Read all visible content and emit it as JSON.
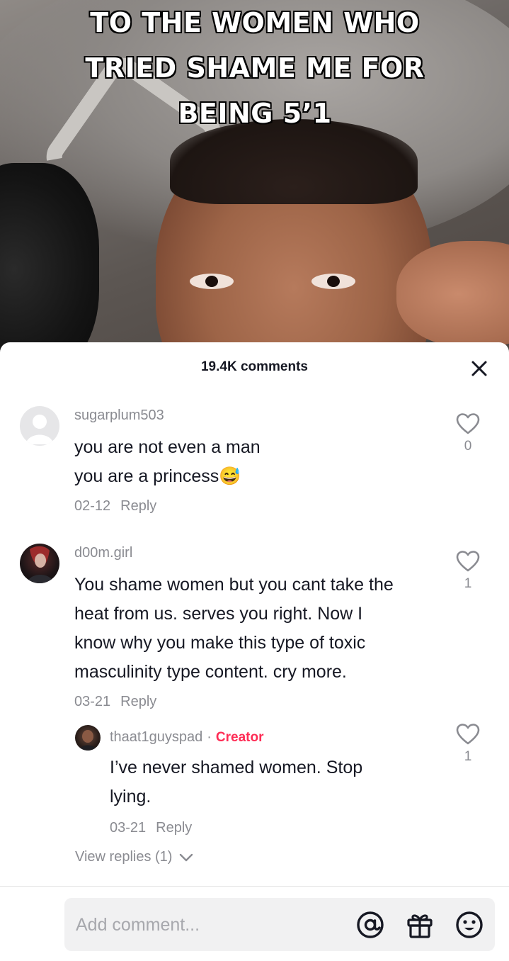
{
  "video": {
    "caption_lines": [
      "TO THE WOMEN WHO",
      "TRIED SHAME ME FOR",
      "BEING 5’1"
    ]
  },
  "comments_panel": {
    "title": "19.4K comments",
    "close_icon": "close-icon",
    "comments": [
      {
        "username": "sugarplum503",
        "text_lines": [
          "you are not even a man",
          "you are a princess"
        ],
        "emoji": "😅",
        "date": "02-12",
        "reply_label": "Reply",
        "likes": "0"
      },
      {
        "username": "d00m.girl",
        "text_lines": [
          "You shame women but you cant take the",
          "heat from us. serves you right. Now I",
          "know why you make this type of toxic",
          "masculinity type content. cry more."
        ],
        "date": "03-21",
        "reply_label": "Reply",
        "likes": "1",
        "reply": {
          "username": "thaat1guyspad",
          "separator": "·",
          "badge": "Creator",
          "text_lines": [
            "I’ve never shamed women. Stop",
            "lying."
          ],
          "date": "03-21",
          "reply_label": "Reply",
          "likes": "1"
        },
        "view_replies": "View replies (1)"
      }
    ]
  },
  "composer": {
    "placeholder": "Add comment...",
    "icons": [
      "at-icon",
      "gift-icon",
      "emoji-icon"
    ]
  },
  "colors": {
    "creator_badge": "#fe2c55",
    "text_primary": "#161823",
    "text_secondary": "#8a8b91",
    "input_bg": "#f1f1f2"
  }
}
